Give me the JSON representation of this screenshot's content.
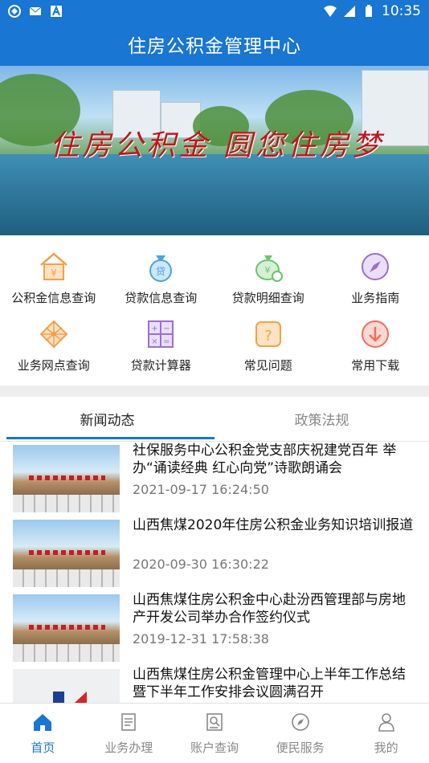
{
  "status_bar": {
    "time": "10:35"
  },
  "header": {
    "title": "住房公积金管理中心"
  },
  "banner": {
    "slogan": "住房公积金 圆您住房梦"
  },
  "menu": {
    "items": [
      {
        "label": "公积金信息查询",
        "icon": "house-yen-icon"
      },
      {
        "label": "贷款信息查询",
        "icon": "loan-bag-icon"
      },
      {
        "label": "贷款明细查询",
        "icon": "money-bag-icon"
      },
      {
        "label": "业务指南",
        "icon": "compass-icon"
      },
      {
        "label": "业务网点查询",
        "icon": "network-icon"
      },
      {
        "label": "贷款计算器",
        "icon": "calculator-icon"
      },
      {
        "label": "常见问题",
        "icon": "question-icon"
      },
      {
        "label": "常用下载",
        "icon": "download-icon"
      }
    ]
  },
  "tabs": [
    {
      "label": "新闻动态",
      "active": true
    },
    {
      "label": "政策法规",
      "active": false
    }
  ],
  "news": [
    {
      "title": "社保服务中心公积金党支部庆祝建党百年 举办“诵读经典 红心向党”诗歌朗诵会",
      "date": "2021-09-17 16:24:50"
    },
    {
      "title": "山西焦煤2020年住房公积金业务知识培训报道",
      "date": "2020-09-30 16:30:22"
    },
    {
      "title": "山西焦煤住房公积金中心赴汾西管理部与房地产开发公司举办合作签约仪式",
      "date": "2019-12-31 17:58:38"
    },
    {
      "title": "山西焦煤住房公积金管理中心上半年工作总结暨下半年工作安排会议圆满召开",
      "date": ""
    }
  ],
  "bottom_nav": [
    {
      "label": "首页",
      "icon": "home-icon",
      "active": true
    },
    {
      "label": "业务办理",
      "icon": "document-icon",
      "active": false
    },
    {
      "label": "账户查询",
      "icon": "account-search-icon",
      "active": false
    },
    {
      "label": "便民服务",
      "icon": "compass-icon",
      "active": false
    },
    {
      "label": "我的",
      "icon": "person-icon",
      "active": false
    }
  ],
  "colors": {
    "primary": "#1976d2",
    "icon_orange": "#f4a04a",
    "icon_blue": "#4aa3df",
    "icon_green": "#6cc26e",
    "icon_purple": "#9b6fd1",
    "icon_red": "#ee6e5c"
  }
}
